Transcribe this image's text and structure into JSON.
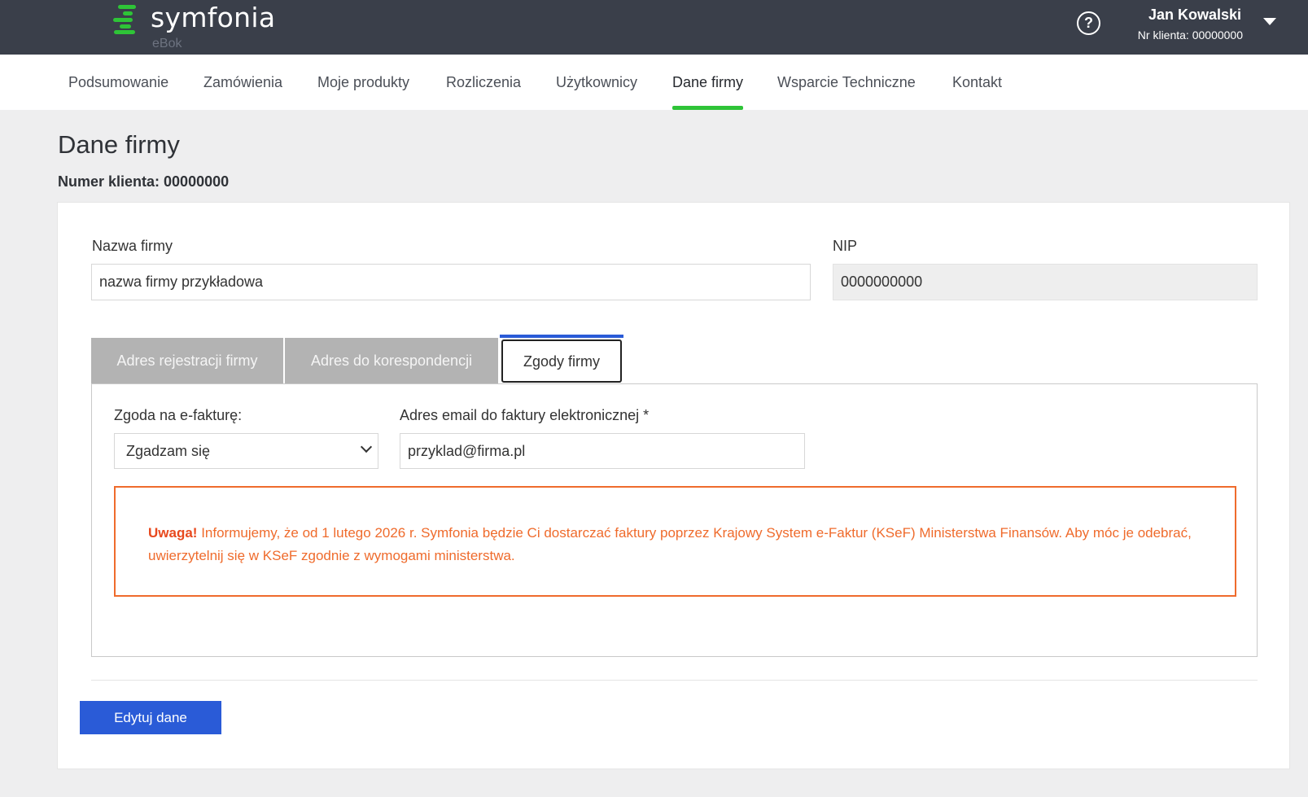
{
  "header": {
    "logo_text": "symfonia",
    "logo_sub": "eBok",
    "help_icon": "question-circle-icon",
    "help_glyph": "?",
    "user_name": "Jan Kowalski",
    "user_client": "Nr klienta: 00000000"
  },
  "nav": {
    "items": [
      {
        "label": "Podsumowanie"
      },
      {
        "label": "Zamówienia"
      },
      {
        "label": "Moje produkty"
      },
      {
        "label": "Rozliczenia"
      },
      {
        "label": "Użytkownicy"
      },
      {
        "label": "Dane firmy"
      },
      {
        "label": "Wsparcie Techniczne"
      },
      {
        "label": "Kontakt"
      }
    ],
    "active": "Dane firmy"
  },
  "page": {
    "title": "Dane firmy",
    "client_number": "Numer klienta: 00000000"
  },
  "form": {
    "company_label": "Nazwa firmy",
    "company_value": "nazwa firmy przykładowa",
    "nip_label": "NIP",
    "nip_value": "0000000000"
  },
  "tabs": [
    {
      "label": "Adres rejestracji firmy"
    },
    {
      "label": "Adres do korespondencji"
    },
    {
      "label": "Zgody firmy"
    }
  ],
  "active_tab": "Zgody firmy",
  "consent": {
    "einvoice_label": "Zgoda na e-fakturę:",
    "einvoice_value": "Zgadzam się",
    "email_label": "Adres email do faktury elektronicznej *",
    "email_value": "przyklad@firma.pl"
  },
  "alert": {
    "title": "Uwaga!",
    "message": "Informujemy, że od 1 lutego 2026 r. Symfonia będzie Ci dostarczać faktury poprzez Krajowy System e-Faktur (KSeF) Ministerstwa Finansów. Aby móc je odebrać, uwierzytelnij się w KSeF zgodnie z wymogami ministerstwa."
  },
  "actions": {
    "edit_label": "Edytuj dane"
  },
  "colors": {
    "header_bg": "#3a3f4a",
    "brand_green": "#2ec437",
    "primary_blue": "#2a5bd7",
    "alert_orange": "#ef6b2c"
  }
}
